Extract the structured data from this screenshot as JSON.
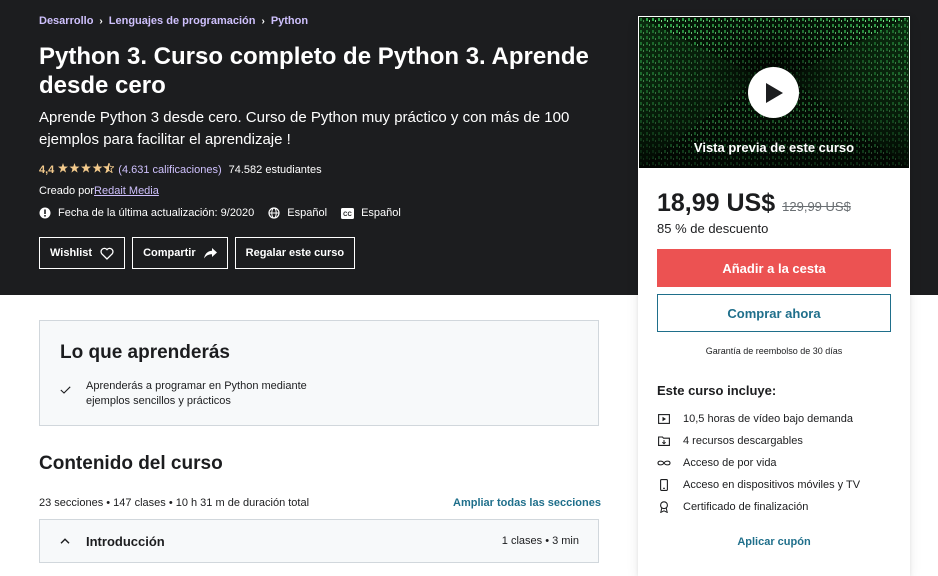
{
  "breadcrumb": [
    "Desarrollo",
    "Lenguajes de programación",
    "Python"
  ],
  "course": {
    "title": "Python 3. Curso completo de Python 3. Aprende desde cero",
    "subtitle": "Aprende Python 3 desde cero. Curso de Python muy práctico y con más de 100 ejemplos para facilitar el aprendizaje !",
    "rating": "4,4",
    "rating_value": 4.4,
    "rating_count": "(4.631 calificaciones)",
    "students": "74.582 estudiantes",
    "created_by_label": "Creado por",
    "instructor": "Redait Media",
    "last_update": "Fecha de la última actualización: 9/2020",
    "language": "Español",
    "captions": "Español"
  },
  "actions": {
    "wishlist": "Wishlist",
    "share": "Compartir",
    "gift": "Regalar este curso"
  },
  "sidebar": {
    "preview_label": "Vista previa de este curso",
    "price": "18,99 US$",
    "old_price": "129,99 US$",
    "discount": "85 % de descuento",
    "add_to_cart": "Añadir a la cesta",
    "buy_now": "Comprar ahora",
    "guarantee": "Garantía de reembolso de 30 días",
    "includes_title": "Este curso incluye:",
    "includes": [
      {
        "icon": "video-icon",
        "text": "10,5 horas de vídeo bajo demanda"
      },
      {
        "icon": "download-folder-icon",
        "text": "4 recursos descargables"
      },
      {
        "icon": "infinity-icon",
        "text": "Acceso de por vida"
      },
      {
        "icon": "mobile-icon",
        "text": "Acceso en dispositivos móviles y TV"
      },
      {
        "icon": "certificate-icon",
        "text": "Certificado de finalización"
      }
    ],
    "coupon": "Aplicar cupón"
  },
  "learn": {
    "title": "Lo que aprenderás",
    "items": [
      "Aprenderás a programar en Python mediante ejemplos sencillos y prácticos"
    ]
  },
  "content": {
    "title": "Contenido del curso",
    "stats": "23 secciones • 147 clases • 10 h 31 m de duración total",
    "expand_all": "Ampliar todas las secciones",
    "sections": [
      {
        "title": "Introducción",
        "meta": "1 clases • 3 min"
      }
    ]
  },
  "colors": {
    "hero_bg": "#1c1d1f",
    "accent_link": "#cec0fc",
    "star": "#f3ca8c",
    "cart_button": "#ec5252",
    "link_blue": "#1f6f8b"
  }
}
